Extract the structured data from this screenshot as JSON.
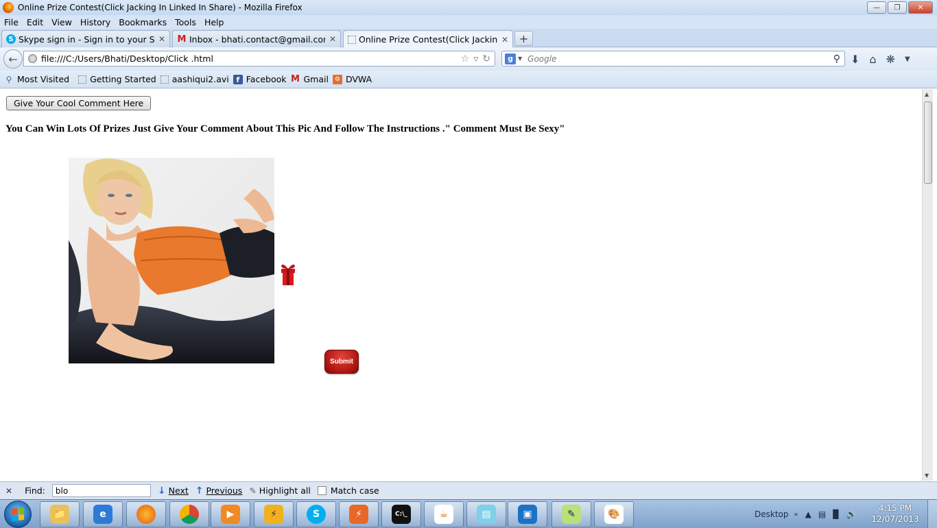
{
  "window": {
    "title": "Online Prize Contest(Click Jacking In Linked In Share) - Mozilla Firefox"
  },
  "menu": [
    "File",
    "Edit",
    "View",
    "History",
    "Bookmarks",
    "Tools",
    "Help"
  ],
  "tabs": [
    {
      "label": "Skype sign in - Sign in to your Skype ...",
      "icon": "skype-icon"
    },
    {
      "label": "Inbox - bhati.contact@gmail.com - G...",
      "icon": "gmail-icon"
    },
    {
      "label": "Online Prize Contest(Click Jacking In ...",
      "icon": "blank-page-icon",
      "active": true
    }
  ],
  "nav": {
    "url": "file:///C:/Users/Bhati/Desktop/Click .html",
    "search_placeholder": "Google"
  },
  "bookmarks": [
    {
      "label": "Most Visited",
      "icon": "most-visited-icon"
    },
    {
      "label": "Getting Started",
      "icon": "blank-page-icon"
    },
    {
      "label": "aashiqui2.avi",
      "icon": "blank-page-icon"
    },
    {
      "label": "Facebook",
      "icon": "facebook-icon"
    },
    {
      "label": "Gmail",
      "icon": "gmail-icon"
    },
    {
      "label": "DVWA",
      "icon": "dvwa-icon"
    }
  ],
  "page": {
    "comment_button": "Give Your Cool Comment Here",
    "heading": "You Can Win Lots Of Prizes Just Give Your Comment About This Pic And Follow The Instructions .\" Comment Must Be Sexy\"",
    "submit_label": "Submit"
  },
  "findbar": {
    "label": "Find:",
    "value": "blo",
    "next": "Next",
    "previous": "Previous",
    "highlight_all": "Highlight all",
    "match_case": "Match case"
  },
  "taskbar": {
    "desktop_label": "Desktop",
    "time": "4:15 PM",
    "date": "12/07/2013"
  },
  "colors": {
    "submit_red": "#b31712",
    "chrome_blue": "#d6e4f5"
  }
}
